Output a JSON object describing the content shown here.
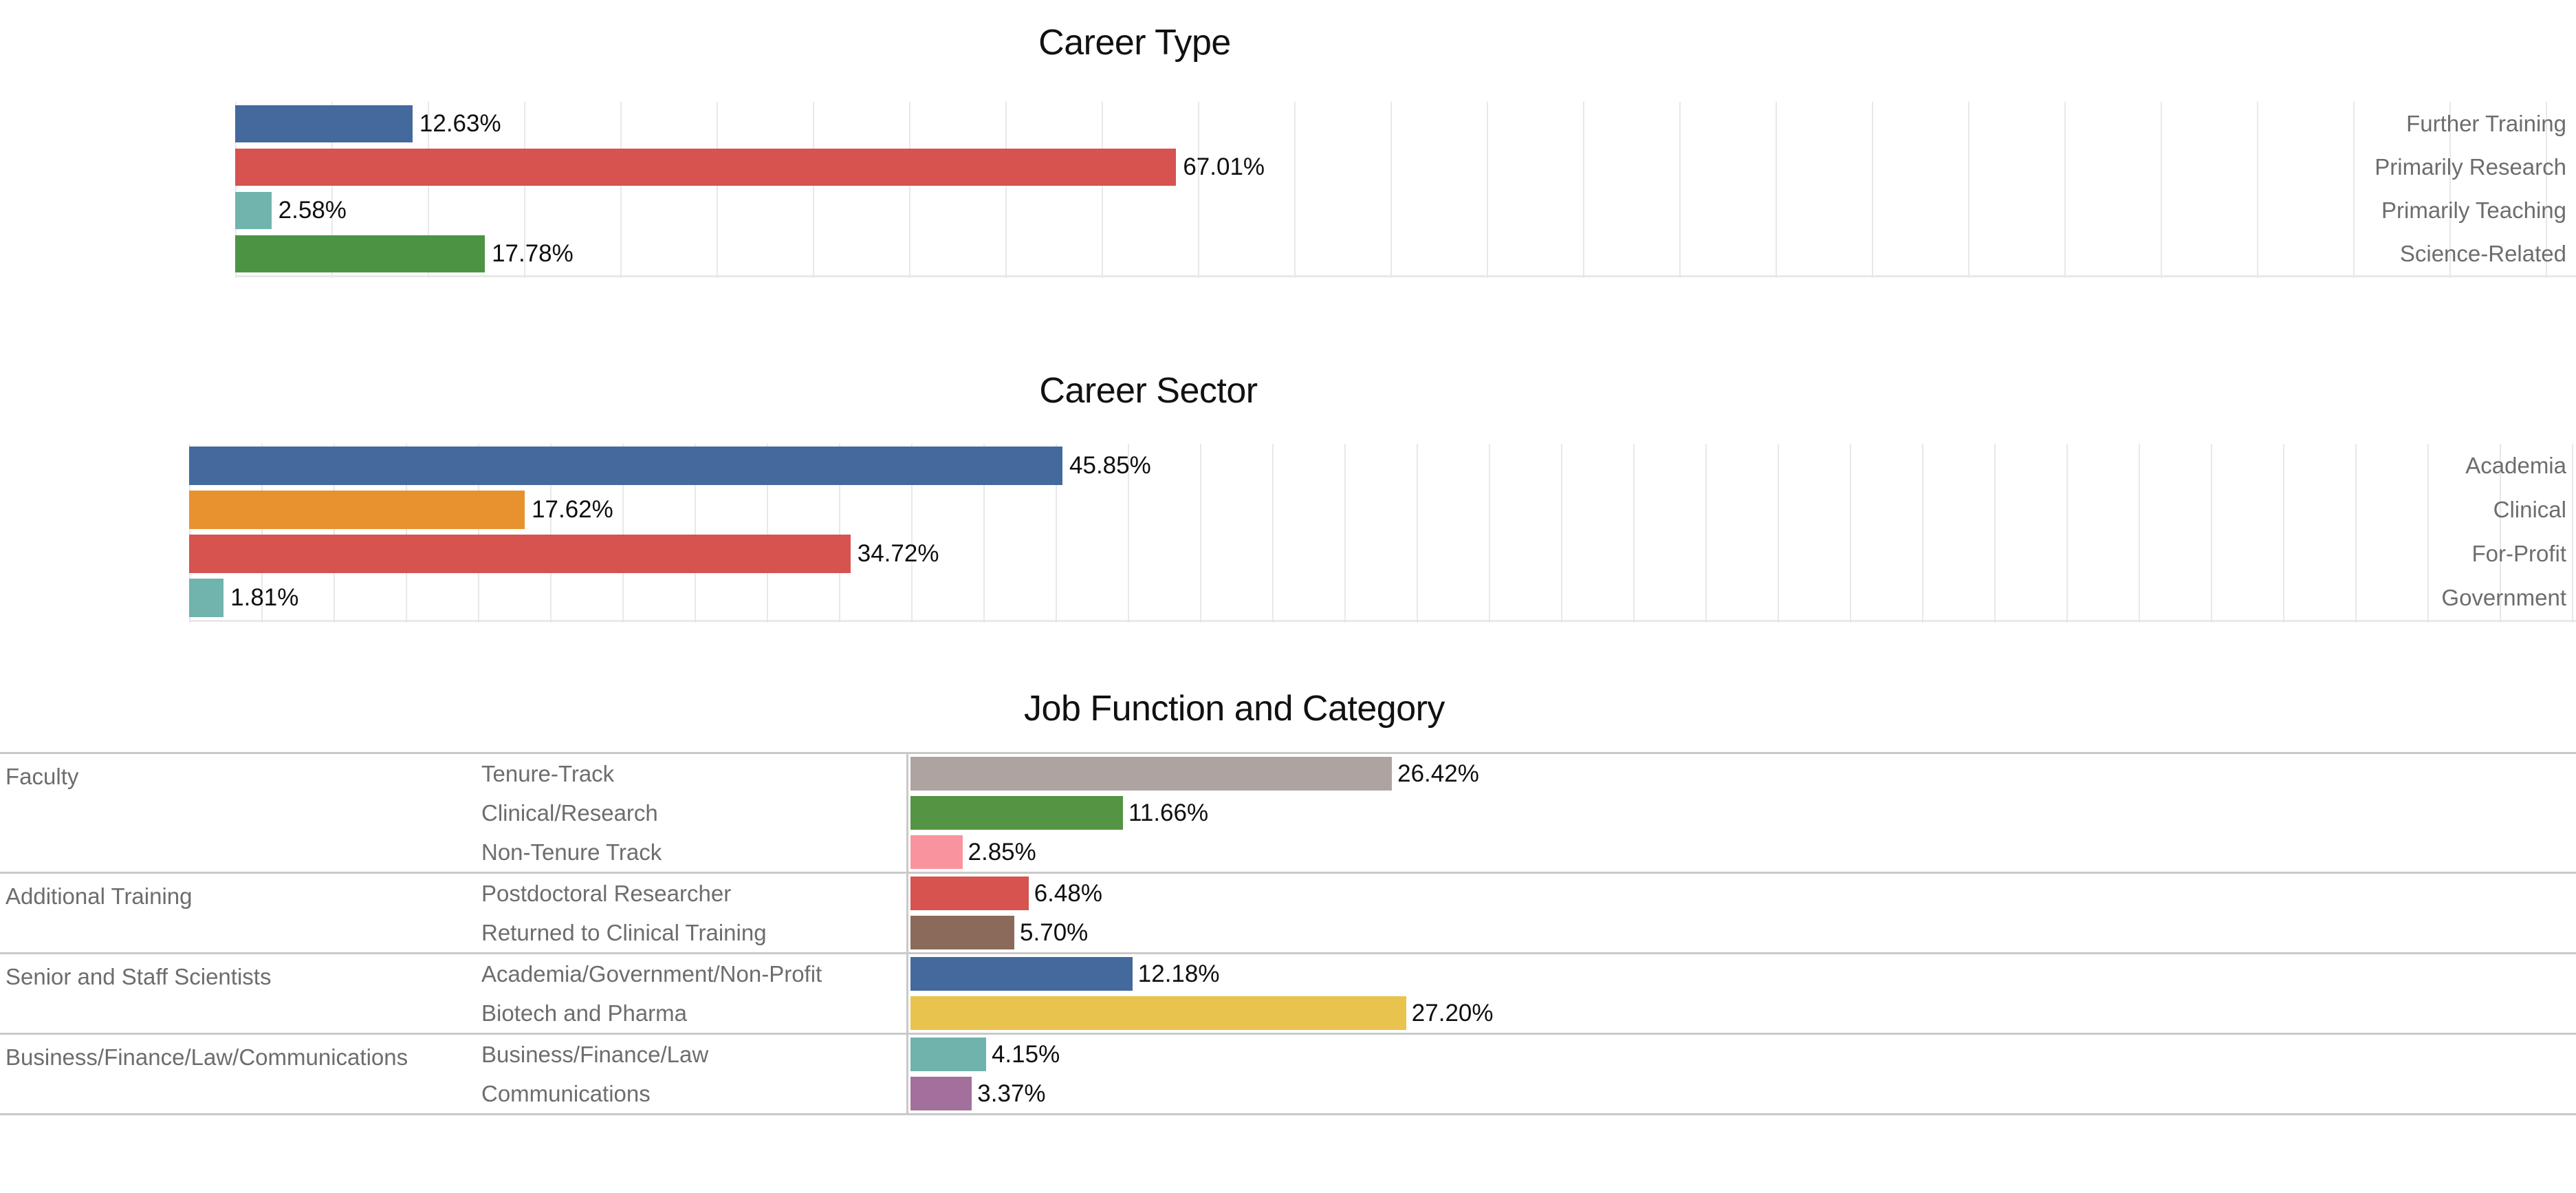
{
  "chart_data": [
    {
      "type": "bar",
      "orientation": "horizontal",
      "title": "Career Type",
      "xlabel": "",
      "ylabel": "",
      "grid": true,
      "value_suffix": "%",
      "xlim": [
        0,
        70
      ],
      "categories": [
        "Further Training",
        "Primarily Research",
        "Primarily Teaching",
        "Science-Related"
      ],
      "values": [
        12.63,
        67.01,
        2.58,
        17.78
      ],
      "value_labels": [
        "12.63%",
        "67.01%",
        "2.58%",
        "17.78%"
      ],
      "colors": [
        "#44699D",
        "#D6534F",
        "#71B3AD",
        "#4C9444"
      ]
    },
    {
      "type": "bar",
      "orientation": "horizontal",
      "title": "Career Sector",
      "xlabel": "",
      "ylabel": "",
      "grid": true,
      "value_suffix": "%",
      "xlim": [
        0,
        46
      ],
      "categories": [
        "Academia",
        "Clinical",
        "For-Profit",
        "Government"
      ],
      "values": [
        45.85,
        17.62,
        34.72,
        1.81
      ],
      "value_labels": [
        "45.85%",
        "17.62%",
        "34.72%",
        "1.81%"
      ],
      "colors": [
        "#44699D",
        "#E8912F",
        "#D6534F",
        "#71B3AD"
      ]
    },
    {
      "type": "bar",
      "orientation": "horizontal",
      "title": "Job Function and Category",
      "xlabel": "",
      "ylabel": "",
      "grid": false,
      "value_suffix": "%",
      "xlim": [
        0,
        28
      ],
      "group_header": "",
      "groups": [
        {
          "category": "Faculty",
          "rows": [
            {
              "subcategory": "Tenure-Track",
              "value": 26.42,
              "value_label": "26.42%",
              "color": "#AFA3A1"
            },
            {
              "subcategory": "Clinical/Research",
              "value": 11.66,
              "value_label": "11.66%",
              "color": "#549443"
            },
            {
              "subcategory": "Non-Tenure Track",
              "value": 2.85,
              "value_label": "2.85%",
              "color": "#F9949E"
            }
          ]
        },
        {
          "category": "Additional Training",
          "rows": [
            {
              "subcategory": "Postdoctoral Researcher",
              "value": 6.48,
              "value_label": "6.48%",
              "color": "#D6534F"
            },
            {
              "subcategory": "Returned to Clinical Training",
              "value": 5.7,
              "value_label": "5.70%",
              "color": "#8B6A5B"
            }
          ]
        },
        {
          "category": "Senior and Staff Scientists",
          "rows": [
            {
              "subcategory": "Academia/Government/Non-Profit",
              "value": 12.18,
              "value_label": "12.18%",
              "color": "#44699D"
            },
            {
              "subcategory": "Biotech and Pharma",
              "value": 27.2,
              "value_label": "27.20%",
              "color": "#E8C34D"
            }
          ]
        },
        {
          "category": "Business/Finance/Law/Communications",
          "rows": [
            {
              "subcategory": "Business/Finance/Law",
              "value": 4.15,
              "value_label": "4.15%",
              "color": "#6FB3AC"
            },
            {
              "subcategory": "Communications",
              "value": 3.37,
              "value_label": "3.37%",
              "color": "#A3709B"
            }
          ]
        }
      ]
    }
  ],
  "charts": {
    "career_type": {
      "title": "Career Type",
      "rows": [
        {
          "label": "Further Training",
          "value_label": "12.63%"
        },
        {
          "label": "Primarily Research",
          "value_label": "67.01%"
        },
        {
          "label": "Primarily Teaching",
          "value_label": "2.58%"
        },
        {
          "label": "Science-Related",
          "value_label": "17.78%"
        }
      ]
    },
    "career_sector": {
      "title": "Career Sector",
      "rows": [
        {
          "label": "Academia",
          "value_label": "45.85%"
        },
        {
          "label": "Clinical",
          "value_label": "17.62%"
        },
        {
          "label": "For-Profit",
          "value_label": "34.72%"
        },
        {
          "label": "Government",
          "value_label": "1.81%"
        }
      ]
    },
    "job_function": {
      "title": "Job Function and Category"
    }
  }
}
